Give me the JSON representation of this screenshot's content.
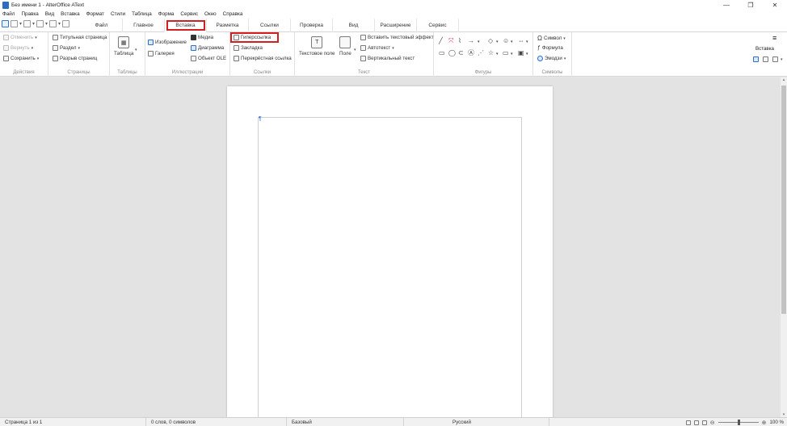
{
  "window": {
    "title": "Без имени 1 - AlterOffice AText",
    "controls": [
      "—",
      "❐",
      "✕"
    ]
  },
  "menu": [
    "Файл",
    "Правка",
    "Вид",
    "Вставка",
    "Формат",
    "Стили",
    "Таблица",
    "Форма",
    "Сервис",
    "Окно",
    "Справка"
  ],
  "tabs": [
    "Файл",
    "Главное",
    "Вставка",
    "Разметка",
    "Ссылки",
    "Проверка",
    "Вид",
    "Расширение",
    "Сервис"
  ],
  "active_tab": "Вставка",
  "ribbon": {
    "actions": {
      "label": "Действия",
      "undo": "Отменить",
      "redo": "Вернуть",
      "save": "Сохранить"
    },
    "pages": {
      "label": "Страницы",
      "title_page": "Титульная страница",
      "section": "Раздел",
      "page_break": "Разрыв страниц"
    },
    "tables": {
      "label": "Таблицы",
      "table": "Таблица"
    },
    "illustrations": {
      "label": "Иллюстрации",
      "image": "Изображение",
      "gallery": "Галерея",
      "media": "Медиа",
      "chart": "Диаграмма",
      "ole": "Объект OLE"
    },
    "links": {
      "label": "Ссылки",
      "hyperlink": "Гиперссылка",
      "bookmark": "Закладка",
      "cross_ref": "Перекрёстная ссылка"
    },
    "text": {
      "label": "Текст",
      "textbox": "Текстовое поле",
      "field": "Поле",
      "fontwork": "Вставить текстовый эффект",
      "autotext": "Автотекст",
      "vertical_text": "Вертикальный текст"
    },
    "shapes": {
      "label": "Фигуры"
    },
    "symbols": {
      "label": "Символы",
      "symbol": "Символ",
      "formula": "Формула",
      "emoji": "Эмодзи"
    },
    "insert": {
      "label": "Вставка"
    }
  },
  "statusbar": {
    "page": "Страница 1 из 1",
    "words": "0 слов, 0 символов",
    "style": "Базовый",
    "language": "Русский",
    "zoom": "100 %"
  },
  "colors": {
    "highlight": "#d21f1f",
    "accent": "#2e6fc7"
  }
}
